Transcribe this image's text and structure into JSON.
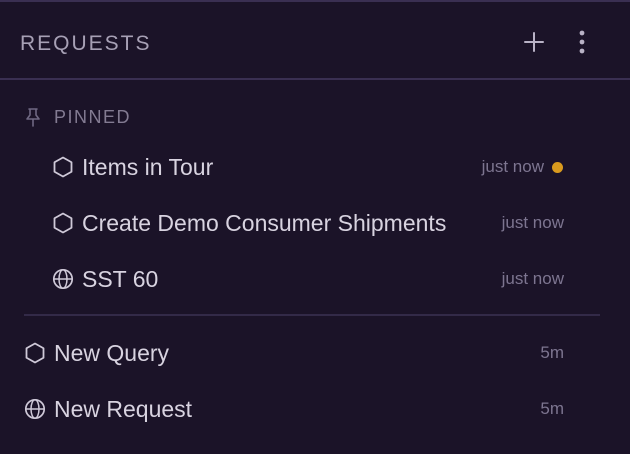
{
  "header": {
    "title": "REQUESTS",
    "add_icon": "plus-icon",
    "more_icon": "vertical-dots-icon"
  },
  "pinned": {
    "label": "PINNED",
    "icon": "pin-icon",
    "items": [
      {
        "name": "Items in Tour",
        "icon": "graphql-hexagon-icon",
        "time": "just now",
        "unsaved": true
      },
      {
        "name": "Create Demo Consumer Shipments",
        "icon": "graphql-hexagon-icon",
        "time": "just now",
        "unsaved": false
      },
      {
        "name": "SST 60",
        "icon": "globe-icon",
        "time": "just now",
        "unsaved": false
      }
    ]
  },
  "recent": {
    "items": [
      {
        "name": "New Query",
        "icon": "graphql-hexagon-icon",
        "time": "5m"
      },
      {
        "name": "New Request",
        "icon": "globe-icon",
        "time": "5m"
      }
    ]
  },
  "colors": {
    "background": "#1b1328",
    "unsaved_dot": "#d99a1e",
    "text": "#d8d3e0",
    "muted": "#7d7590"
  }
}
